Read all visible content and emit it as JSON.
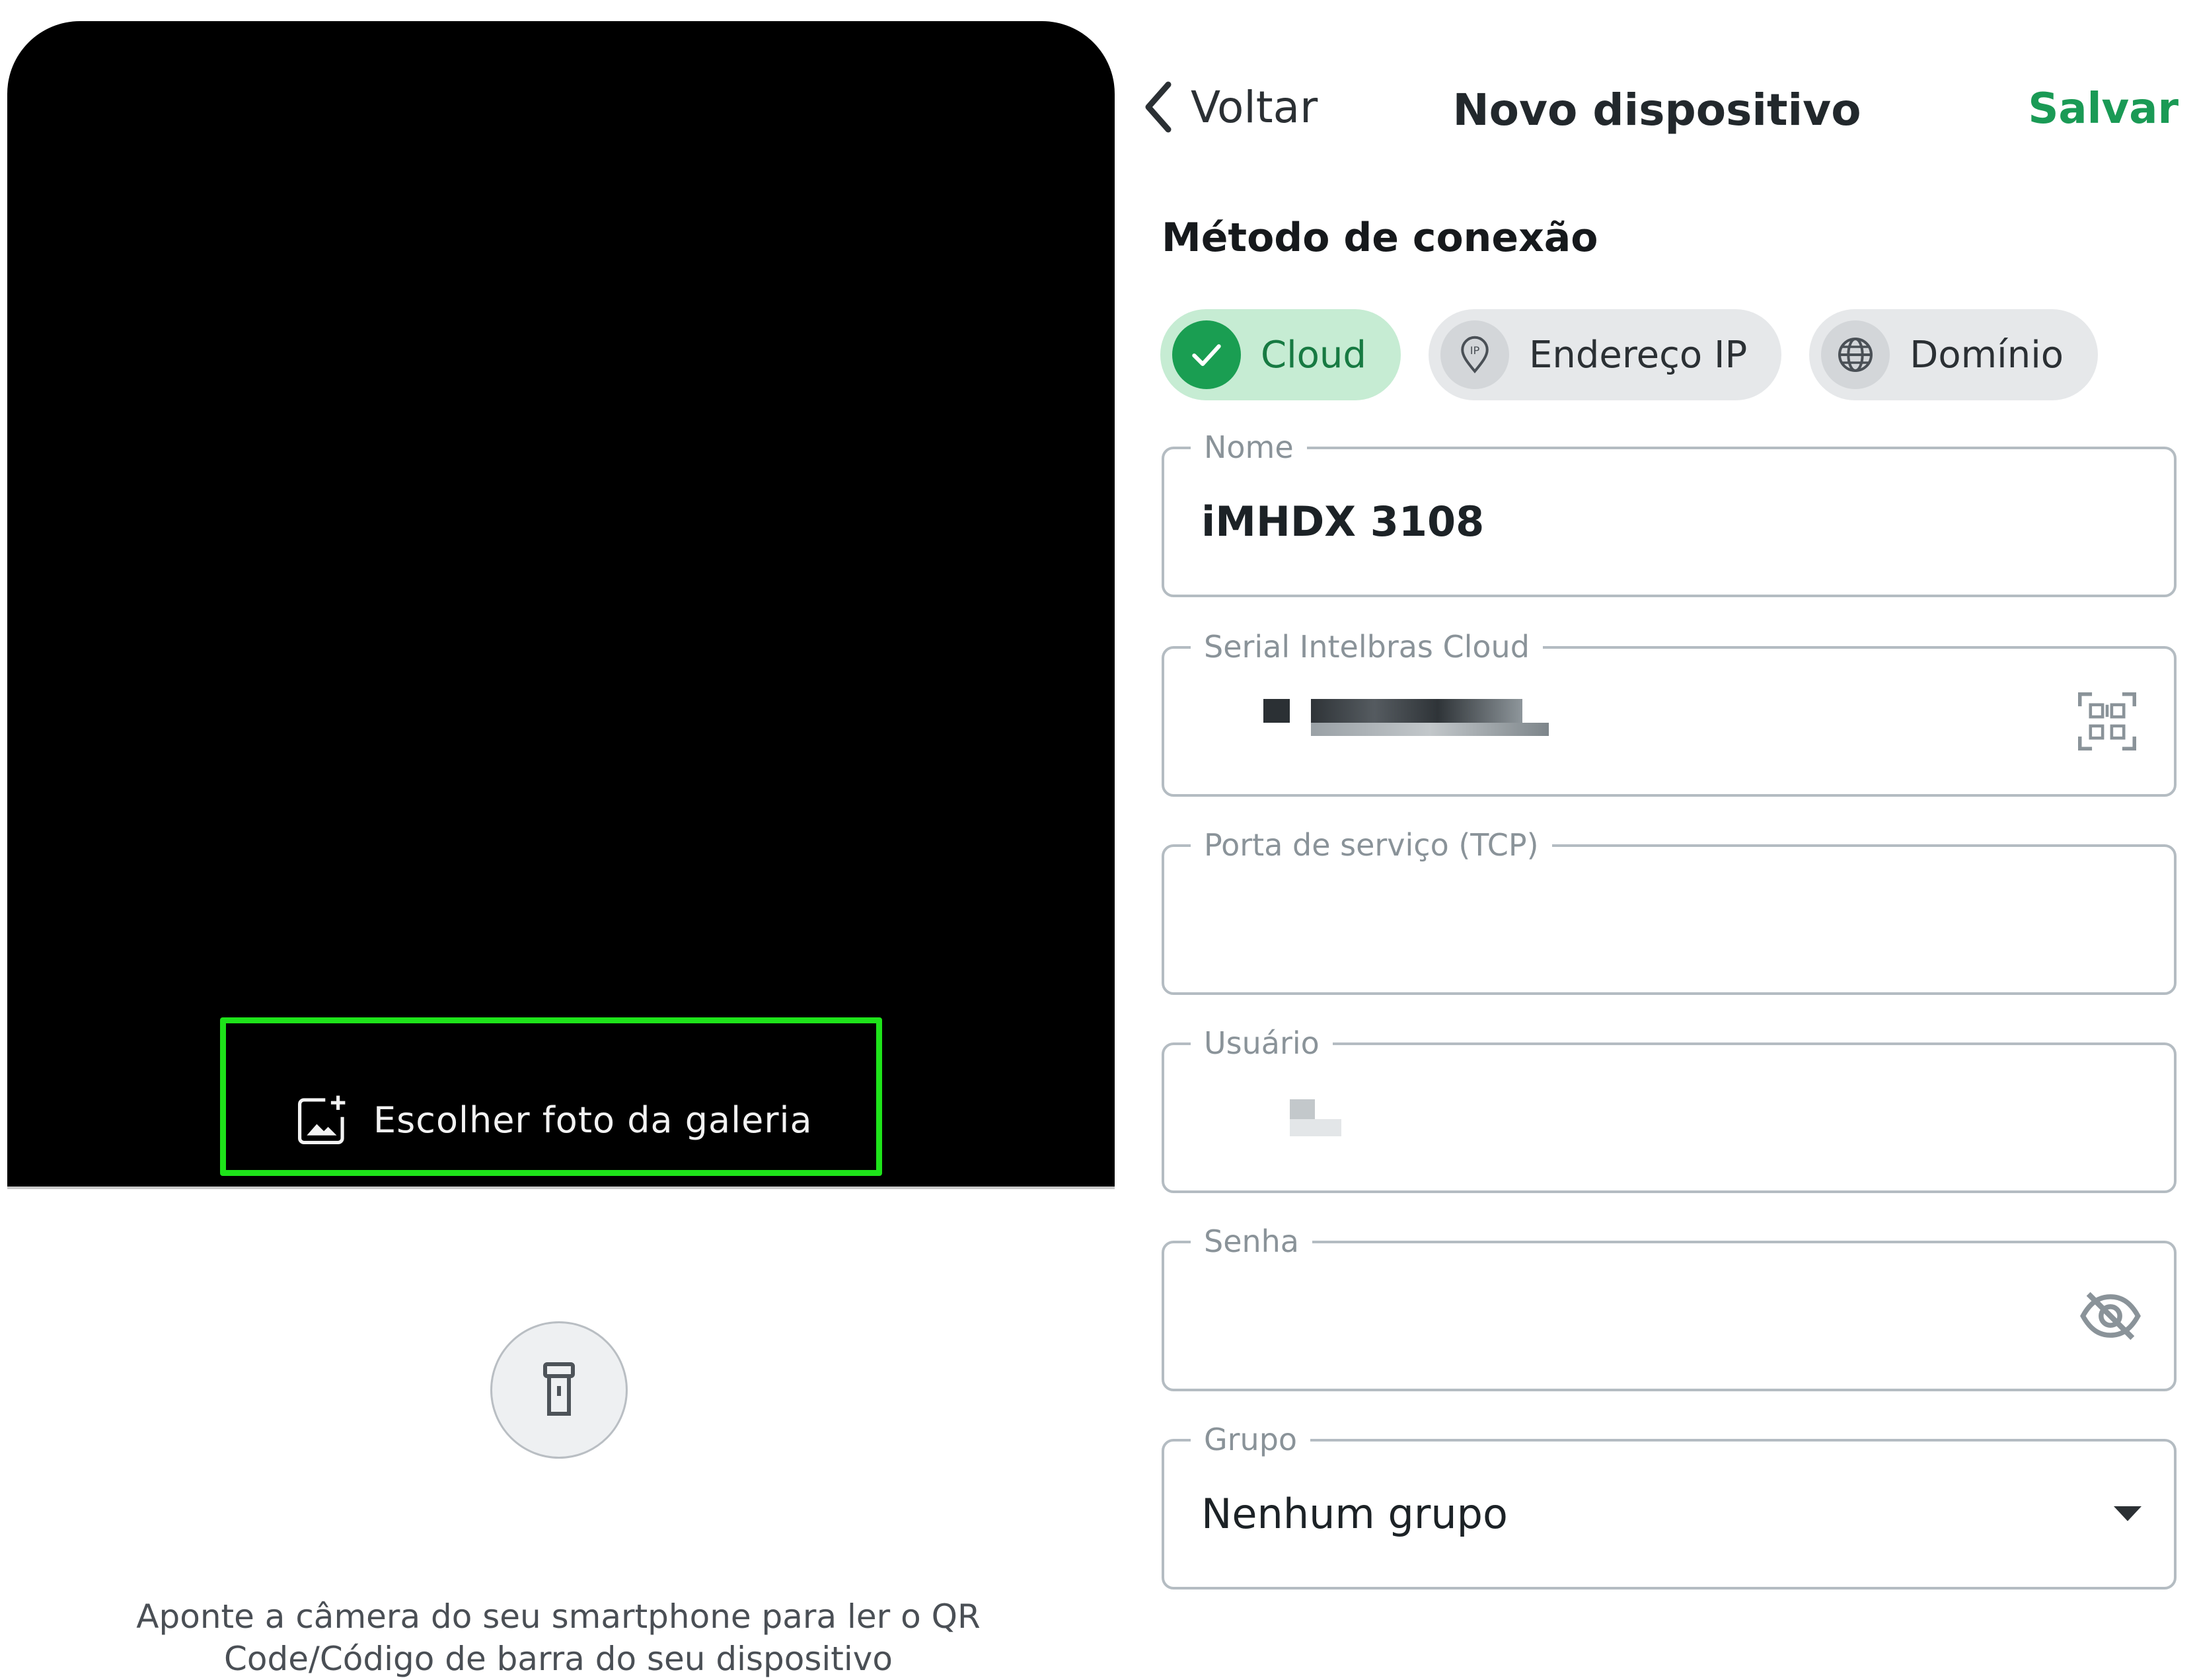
{
  "scanner": {
    "gallery_button_label": "Escolher foto da galeria",
    "gallery_icon": "gallery-add-icon",
    "flash_icon": "flashlight-icon",
    "hint_text": "Aponte a câmera do seu smartphone para ler o QR Code/Código de barra do seu dispositivo",
    "highlight_color": "#1ee31a"
  },
  "header": {
    "back_label": "Voltar",
    "title": "Novo dispositivo",
    "save_label": "Salvar"
  },
  "connection": {
    "section_title": "Método de conexão",
    "options": [
      {
        "label": "Cloud",
        "icon": "check-icon",
        "selected": true
      },
      {
        "label": "Endereço IP",
        "icon": "ip-pin-icon",
        "selected": false
      },
      {
        "label": "Domínio",
        "icon": "globe-icon",
        "selected": false
      }
    ]
  },
  "form": {
    "name": {
      "label": "Nome",
      "value": "iMHDX 3108"
    },
    "serial": {
      "label": "Serial Intelbras Cloud",
      "trailing_icon": "qr-scan-icon"
    },
    "port": {
      "label": "Porta de serviço (TCP)",
      "value": ""
    },
    "user": {
      "label": "Usuário"
    },
    "password": {
      "label": "Senha",
      "trailing_icon": "eye-off-icon"
    },
    "group": {
      "label": "Grupo",
      "value": "Nenhum grupo",
      "trailing_icon": "dropdown-arrow-icon"
    }
  },
  "colors": {
    "accent": "#1a9a55",
    "selected_chip_bg": "#c6ecd3",
    "camera_bg": "#000000"
  }
}
